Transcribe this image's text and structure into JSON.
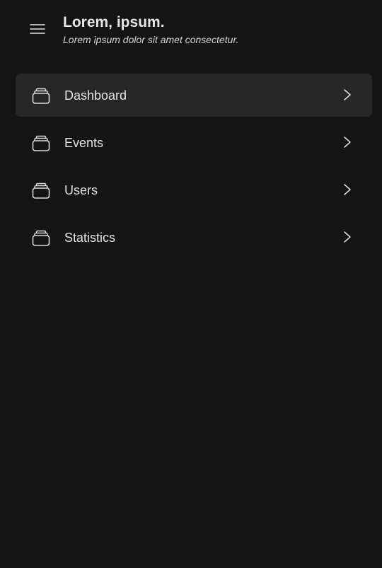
{
  "header": {
    "title": "Lorem, ipsum.",
    "subtitle": "Lorem ipsum dolor sit amet consectetur.",
    "menu_icon": "hamburger-menu-icon"
  },
  "nav": {
    "items": [
      {
        "label": "Dashboard",
        "icon": "stack-icon",
        "active": true
      },
      {
        "label": "Events",
        "icon": "stack-icon",
        "active": false
      },
      {
        "label": "Users",
        "icon": "stack-icon",
        "active": false
      },
      {
        "label": "Statistics",
        "icon": "stack-icon",
        "active": false
      }
    ],
    "chevron_icon": "chevron-right-icon"
  },
  "colors": {
    "background": "#141414",
    "active_item_background": "#272727",
    "text": "#e6e6e6"
  }
}
